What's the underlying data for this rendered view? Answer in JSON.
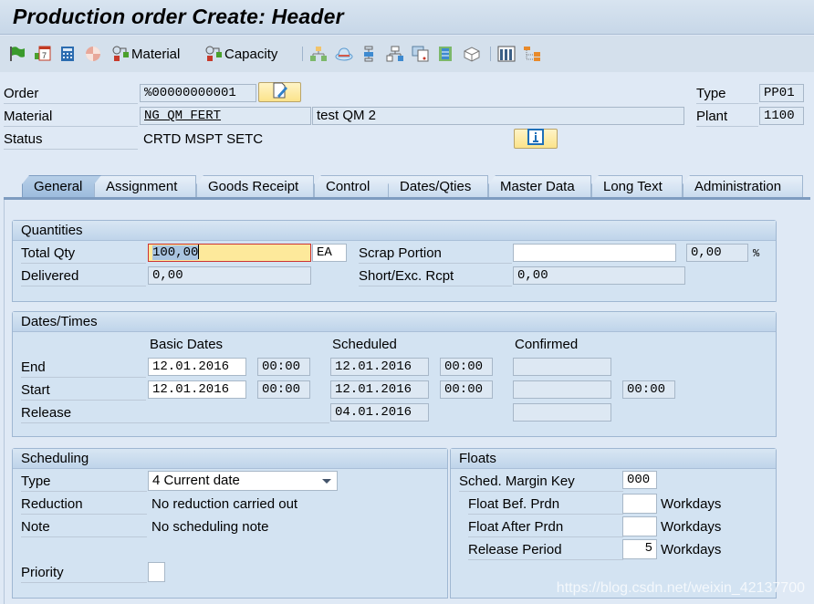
{
  "window": {
    "title": "Production order Create: Header"
  },
  "toolbar": {
    "icons_left": [
      "flag-icon",
      "calendar-icon",
      "calculator-icon",
      "pie-icon"
    ],
    "material_label": "Material",
    "capacity_label": "Capacity",
    "icons_right": [
      "hierarchy-icon",
      "hat-icon",
      "sequence-icon",
      "network-icon",
      "document-icon",
      "binder-icon",
      "box-icon",
      "columns-icon",
      "tree-icon"
    ]
  },
  "header": {
    "order_label": "Order",
    "order_value": "%00000000001",
    "material_label": "Material",
    "material_value": "NG_QM_FERT",
    "material_desc": "test QM 2",
    "status_label": "Status",
    "status_value": "CRTD MSPT SETC",
    "type_label": "Type",
    "type_value": "PP01",
    "plant_label": "Plant",
    "plant_value": "1100"
  },
  "tabs": [
    {
      "label": "General",
      "active": true
    },
    {
      "label": "Assignment"
    },
    {
      "label": "Goods Receipt"
    },
    {
      "label": "Control"
    },
    {
      "label": "Dates/Qties"
    },
    {
      "label": "Master Data"
    },
    {
      "label": "Long Text"
    },
    {
      "label": "Administration"
    }
  ],
  "quantities": {
    "title": "Quantities",
    "total_qty_label": "Total Qty",
    "total_qty_value": "100,00",
    "unit": "EA",
    "delivered_label": "Delivered",
    "delivered_value": "0,00",
    "scrap_label": "Scrap Portion",
    "scrap_value": "",
    "scrap_pct": "0,00",
    "pct_sign": "%",
    "short_label": "Short/Exc. Rcpt",
    "short_value": "0,00"
  },
  "dates": {
    "title": "Dates/Times",
    "col_basic": "Basic Dates",
    "col_scheduled": "Scheduled",
    "col_confirmed": "Confirmed",
    "end_label": "End",
    "start_label": "Start",
    "release_label": "Release",
    "end_basic_date": "12.01.2016",
    "end_basic_time": "00:00",
    "end_sched_date": "12.01.2016",
    "end_sched_time": "00:00",
    "end_conf_date": "",
    "start_basic_date": "12.01.2016",
    "start_basic_time": "00:00",
    "start_sched_date": "12.01.2016",
    "start_sched_time": "00:00",
    "start_conf_date": "",
    "start_conf_time": "00:00",
    "release_sched_date": "04.01.2016",
    "release_conf_date": ""
  },
  "scheduling": {
    "title": "Scheduling",
    "type_label": "Type",
    "type_value": "4 Current date",
    "reduction_label": "Reduction",
    "reduction_value": "No reduction carried out",
    "note_label": "Note",
    "note_value": "No scheduling note",
    "priority_label": "Priority",
    "priority_value": ""
  },
  "floats": {
    "title": "Floats",
    "margin_key_label": "Sched. Margin Key",
    "margin_key_value": "000",
    "float_bef_label": "Float Bef. Prdn",
    "float_bef_value": "",
    "float_after_label": "Float After Prdn",
    "float_after_value": "",
    "release_period_label": "Release Period",
    "release_period_value": "5",
    "unit": "Workdays"
  },
  "watermark": "https://blog.csdn.net/weixin_42137700"
}
